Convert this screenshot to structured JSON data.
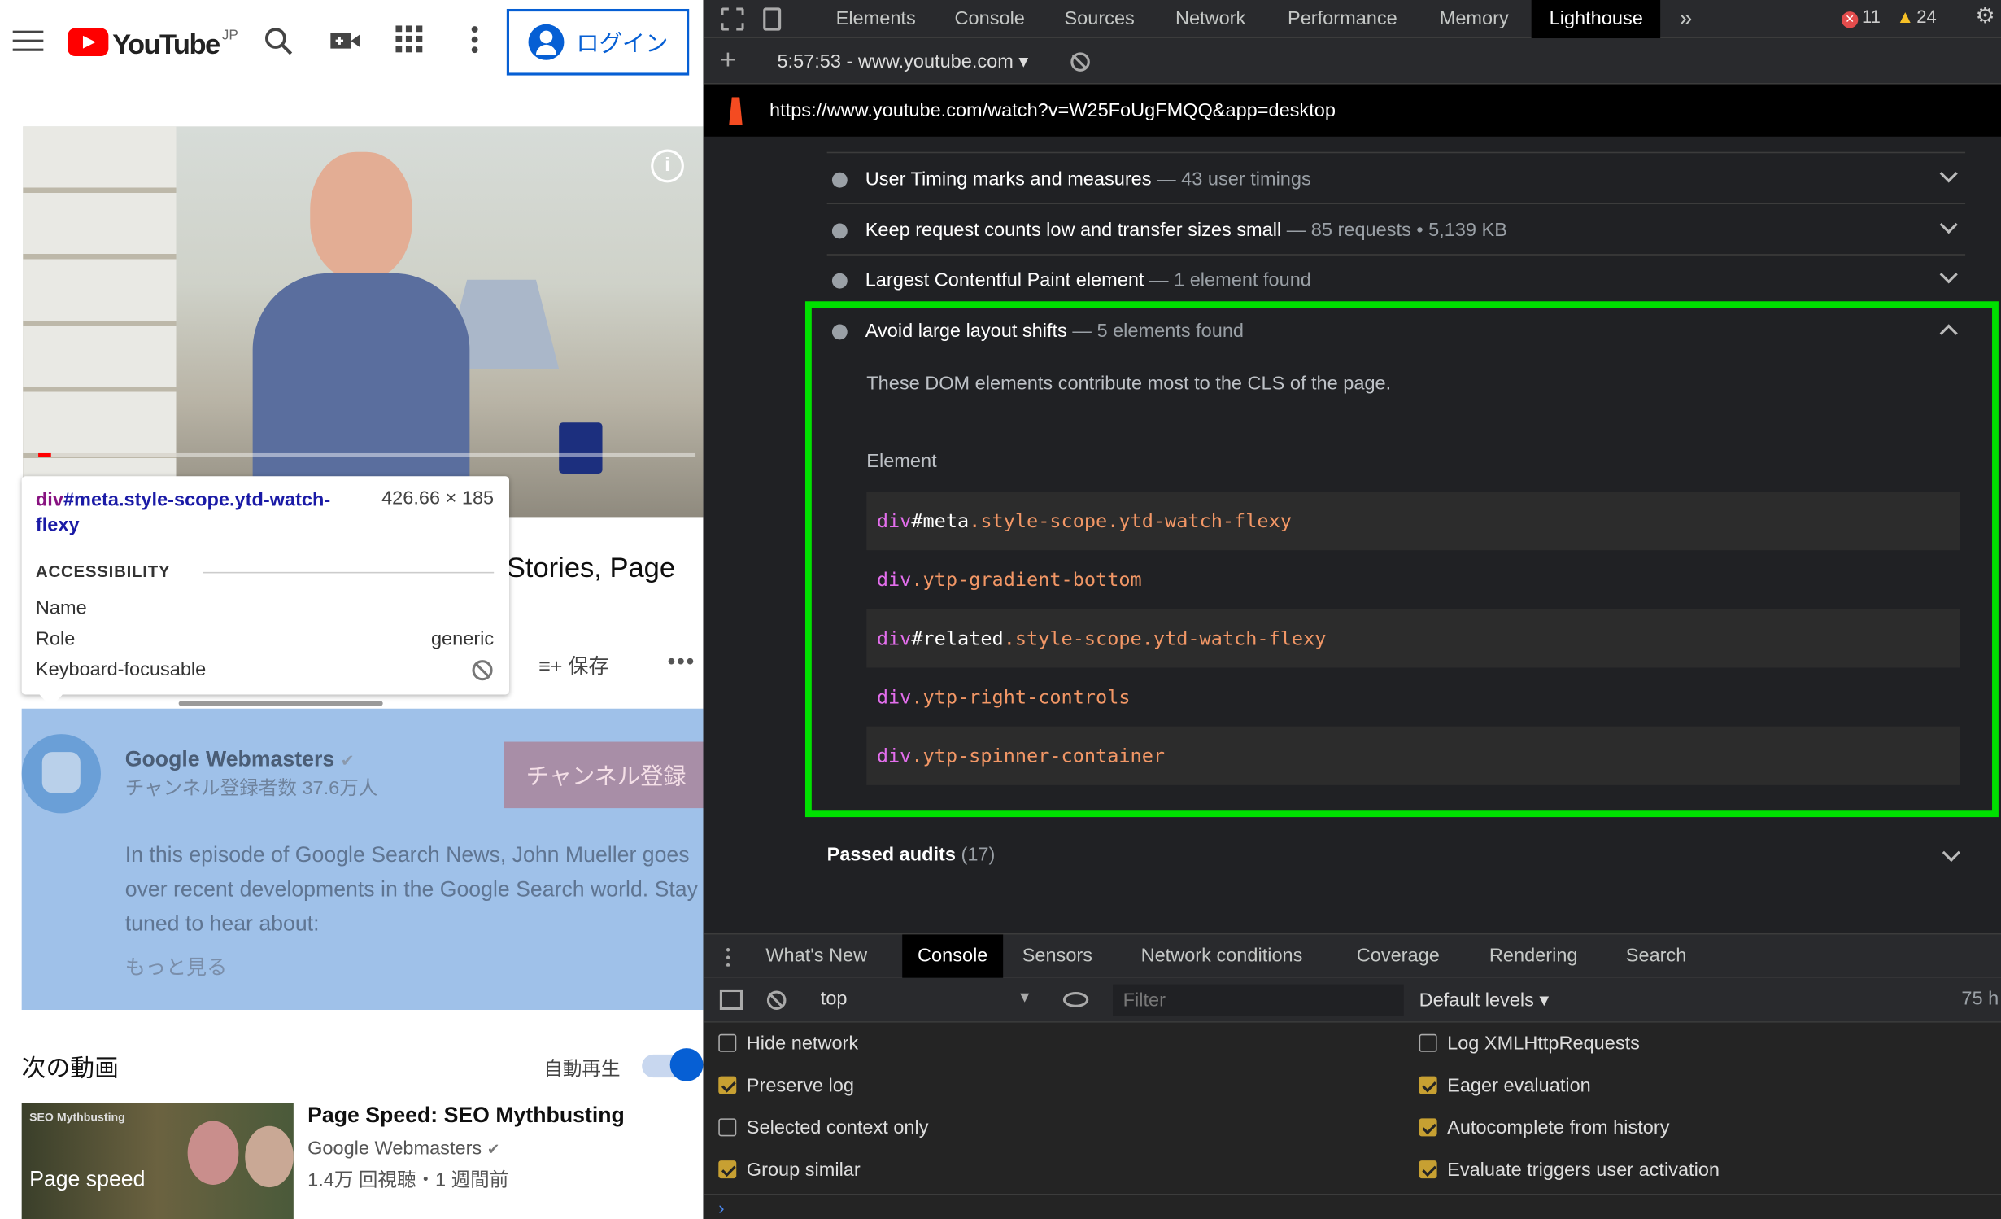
{
  "youtube": {
    "logo_text": "YouTube",
    "logo_region": "JP",
    "login_label": "ログイン",
    "video_title_fragment": "Stories, Page",
    "save_label": "保存",
    "channel_name": "Google Webmasters",
    "channel_subs": "チャンネル登録者数 37.6万人",
    "subscribe_label": "チャンネル登録",
    "description": "In this episode of Google Search News, John Mueller goes over recent developments in the Google Search world. Stay tuned to hear about:",
    "show_more": "もっと見る",
    "next_heading": "次の動画",
    "autoplay_label": "自動再生",
    "related": {
      "thumb_tag": "SEO Mythbusting",
      "thumb_text": "Page speed",
      "title": "Page Speed: SEO Mythbusting",
      "channel": "Google Webmasters",
      "meta": "1.4万 回視聴・1 週間前"
    }
  },
  "tooltip": {
    "selector_tag": "div",
    "selector_rest": "#meta.style-scope.ytd-watch-flexy",
    "dimensions": "426.66 × 185",
    "section": "ACCESSIBILITY",
    "name_label": "Name",
    "role_label": "Role",
    "role_value": "generic",
    "focus_label": "Keyboard-focusable"
  },
  "devtools": {
    "tabs": [
      "Elements",
      "Console",
      "Sources",
      "Network",
      "Performance",
      "Memory",
      "Lighthouse"
    ],
    "more_tabs": "»",
    "errors": "11",
    "warnings": "24",
    "session": "5:57:53 - www.youtube.com",
    "url": "https://www.youtube.com/watch?v=W25FoUgFMQQ&app=desktop",
    "audits": [
      {
        "title": "User Timing marks and measures",
        "detail": "43 user timings"
      },
      {
        "title": "Keep request counts low and transfer sizes small",
        "detail": "85 requests • 5,139 KB"
      },
      {
        "title": "Largest Contentful Paint element",
        "detail": "1 element found"
      },
      {
        "title": "Avoid large layout shifts",
        "detail": "5 elements found"
      }
    ],
    "expanded_desc": "These DOM elements contribute most to the CLS of the page.",
    "element_header": "Element",
    "elements": [
      {
        "tag": "div",
        "id": "#meta",
        "cls": ".style-scope.ytd-watch-flexy"
      },
      {
        "tag": "div",
        "id": "",
        "cls": ".ytp-gradient-bottom"
      },
      {
        "tag": "div",
        "id": "#related",
        "cls": ".style-scope.ytd-watch-flexy"
      },
      {
        "tag": "div",
        "id": "",
        "cls": ".ytp-right-controls"
      },
      {
        "tag": "div",
        "id": "",
        "cls": ".ytp-spinner-container"
      }
    ],
    "passed_label": "Passed audits",
    "passed_count": "(17)",
    "drawer_tabs": [
      "What's New",
      "Console",
      "Sensors",
      "Network conditions",
      "Coverage",
      "Rendering",
      "Search"
    ],
    "context": "top",
    "filter_placeholder": "Filter",
    "levels": "Default levels ▾",
    "hidden_count": "75 h",
    "options_left": [
      {
        "label": "Hide network",
        "checked": false
      },
      {
        "label": "Preserve log",
        "checked": true
      },
      {
        "label": "Selected context only",
        "checked": false
      },
      {
        "label": "Group similar",
        "checked": true
      }
    ],
    "options_right": [
      {
        "label": "Log XMLHttpRequests",
        "checked": false
      },
      {
        "label": "Eager evaluation",
        "checked": true
      },
      {
        "label": "Autocomplete from history",
        "checked": true
      },
      {
        "label": "Evaluate triggers user activation",
        "checked": true
      }
    ]
  }
}
